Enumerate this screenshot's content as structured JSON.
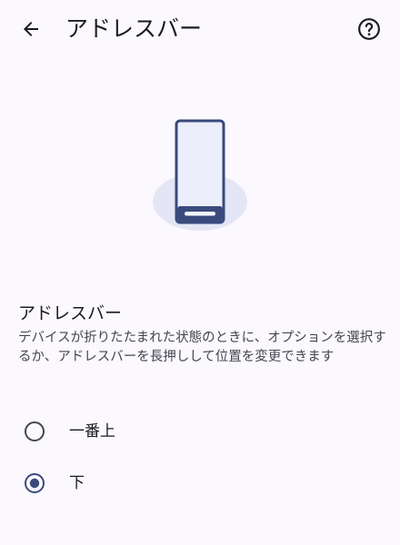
{
  "header": {
    "title": "アドレスバー",
    "back_icon": "arrow-back-icon",
    "help_icon": "help-circle-icon"
  },
  "section": {
    "title": "アドレスバー",
    "description": "デバイスが折りたたまれた状態のときに、オプションを選択するか、アドレスバーを長押しして位置を変更できます"
  },
  "options": [
    {
      "label": "一番上",
      "selected": false
    },
    {
      "label": "下",
      "selected": true
    }
  ],
  "colors": {
    "background": "#fbf8fe",
    "accent": "#3a4a7c",
    "text_primary": "#1b1b21",
    "text_secondary": "#46464f"
  }
}
